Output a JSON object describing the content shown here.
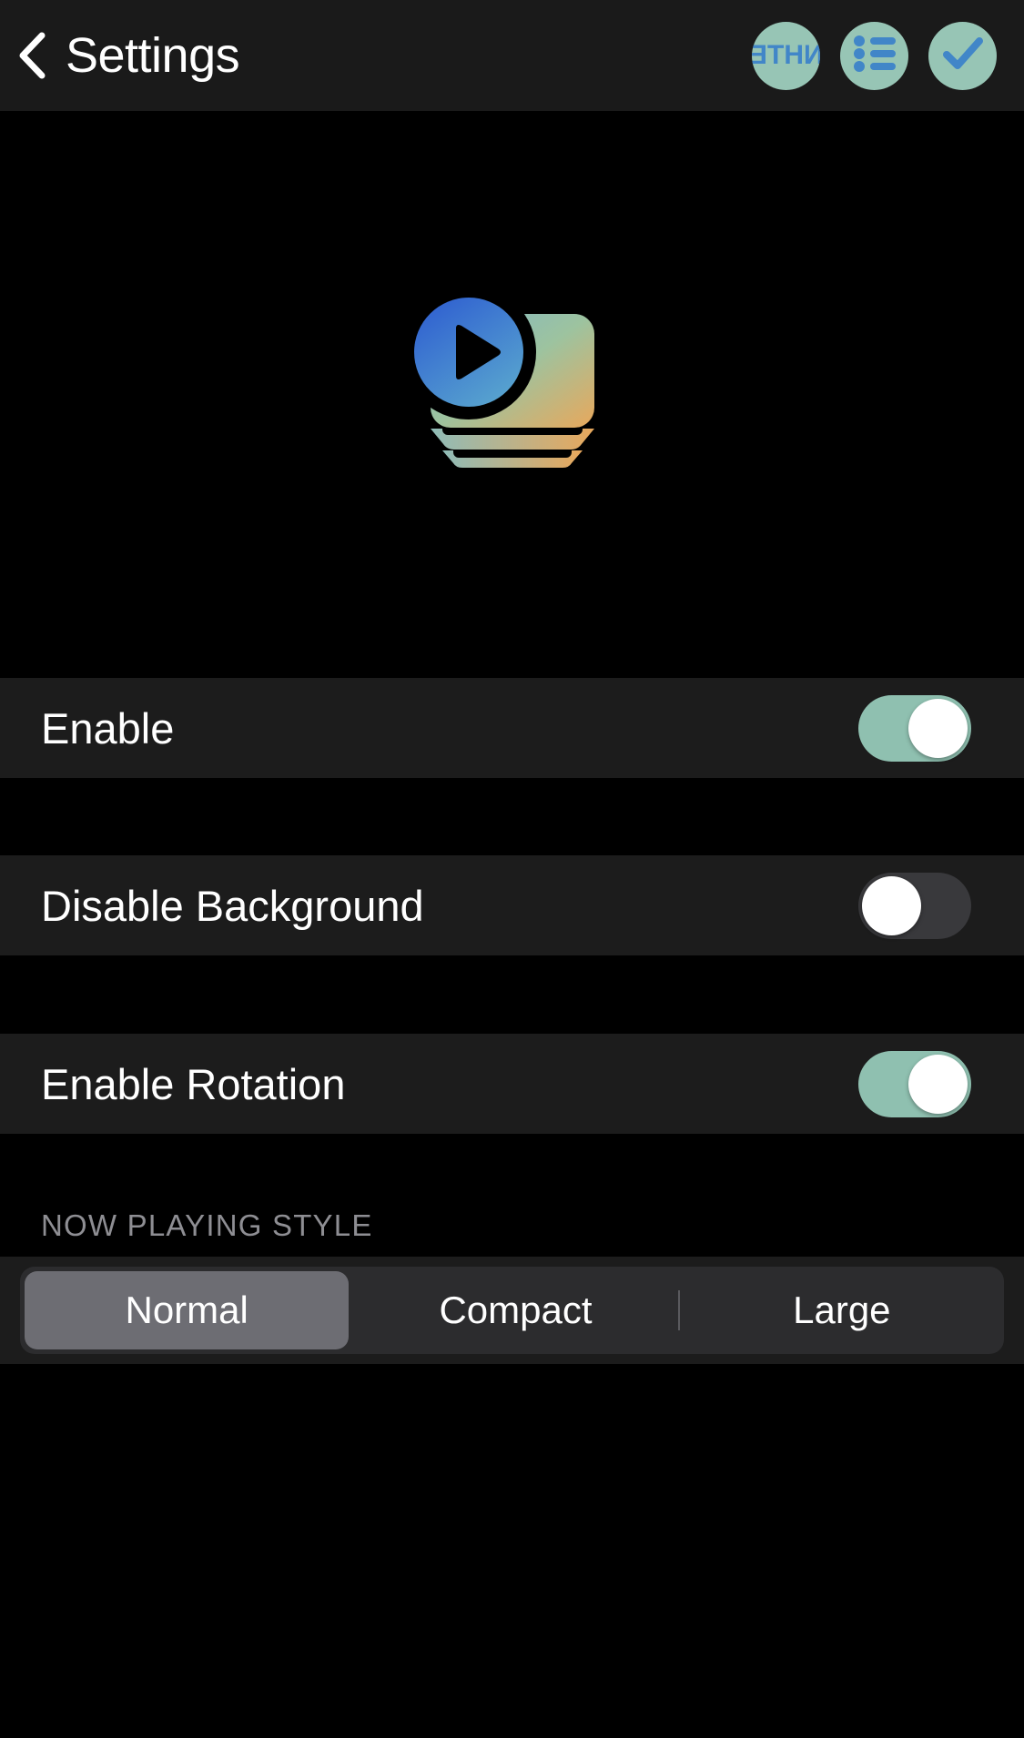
{
  "header": {
    "back_icon": "chevron-left-icon",
    "title": "Settings",
    "actions": [
      {
        "icon": "nhte-logo-icon",
        "label": "NHTE"
      },
      {
        "icon": "bulleted-list-icon",
        "label": ""
      },
      {
        "icon": "checkmark-icon",
        "label": ""
      }
    ],
    "accent_circle_color": "#97c5b5",
    "accent_glyph_color": "#4186c8"
  },
  "logo": {
    "name": "app-logo-play-cards",
    "play_gradient_from": "#2f5fd0",
    "play_gradient_to": "#5aa8cf",
    "card_gradient_from": "#7fb6c9",
    "card_gradient_mid": "#9dc39f",
    "card_gradient_to": "#e8a85c"
  },
  "settings": {
    "rows": [
      {
        "label": "Enable",
        "toggle_state": "on",
        "name": "enable"
      },
      {
        "label": "Disable Background",
        "toggle_state": "off",
        "name": "disable-background"
      },
      {
        "label": "Enable Rotation",
        "toggle_state": "on",
        "name": "enable-rotation"
      }
    ],
    "toggle_on_color": "#8fc0b0",
    "toggle_off_color": "#39393c",
    "knob_color": "#ffffff"
  },
  "now_playing_style": {
    "section_title": "NOW PLAYING STYLE",
    "options": [
      {
        "label": "Normal",
        "selected": true
      },
      {
        "label": "Compact",
        "selected": false
      },
      {
        "label": "Large",
        "selected": false
      }
    ],
    "selected_value": "Normal",
    "track_color": "#2c2c2e",
    "selected_color": "#6d6d73"
  }
}
